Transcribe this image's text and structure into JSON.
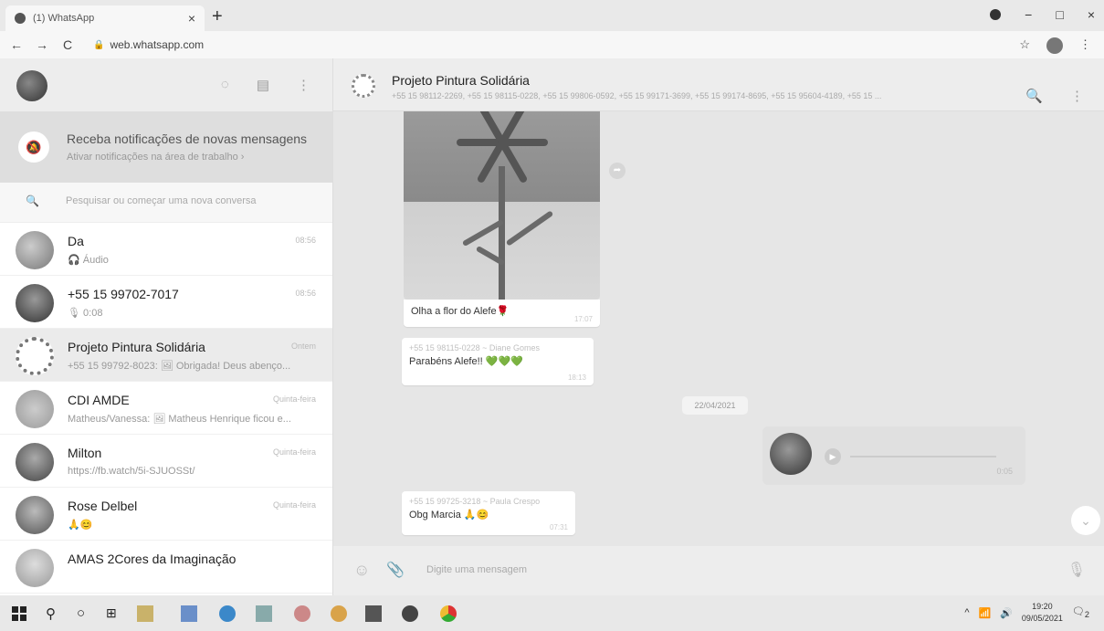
{
  "browser": {
    "tab_title": "(1) WhatsApp",
    "tab_close": "×",
    "new_tab": "+",
    "url": "web.whatsapp.com",
    "back": "←",
    "forward": "→",
    "reload": "C",
    "star": "☆",
    "menu": "⋮",
    "min": "−",
    "max": "□",
    "close": "×"
  },
  "left": {
    "notification": {
      "title": "Receba notificações de novas mensagens",
      "subtitle": "Ativar notificações na área de trabalho ›"
    },
    "search_placeholder": "Pesquisar ou começar uma nova conversa",
    "chats": [
      {
        "name": "Da",
        "time": "08:56",
        "preview": "🎧 Áudio"
      },
      {
        "name": "+55 15 99702-7017",
        "time": "08:56",
        "preview": "🎙 0:08"
      },
      {
        "name": "Projeto Pintura Solidária",
        "time": "Ontem",
        "preview": "+55 15 99792-8023: 🖼 Obrigada! Deus abenço..."
      },
      {
        "name": "CDI AMDE",
        "time": "Quinta-feira",
        "preview": "Matheus/Vanessa: 🖼 Matheus Henrique ficou e..."
      },
      {
        "name": "Milton",
        "time": "Quinta-feira",
        "preview": "https://fb.watch/5i-SJUOSSt/"
      },
      {
        "name": "Rose Delbel",
        "time": "Quinta-feira",
        "preview": "🙏😊"
      },
      {
        "name": "AMAS 2Cores da Imaginação",
        "time": "",
        "preview": ""
      }
    ]
  },
  "conversation": {
    "group_name": "Projeto Pintura Solidária",
    "members": "+55 15 98112-2269, +55 15 98115-0228, +55 15 99806-0592, +55 15 99171-3699, +55 15 99174-8695, +55 15 95604-4189, +55 15 ...",
    "image_caption": "Olha a flor do Alefe🌹",
    "image_time": "17:07",
    "msg2": {
      "sender": "+55 15 98115-0228",
      "sender_name": "~ Diane Gomes",
      "text": "Parabéns Alefe!! 💚💚💚",
      "time": "18:13"
    },
    "date_chip": "22/04/2021",
    "audio": {
      "duration": "0:05",
      "play": "▶"
    },
    "msg3": {
      "sender": "+55 15 99725-3218",
      "sender_name": "~ Paula Crespo",
      "text": "Obg Marcia 🙏😊",
      "time": "07:31"
    },
    "compose_placeholder": "Digite uma mensagem"
  },
  "taskbar": {
    "time": "19:20",
    "date": "09/05/2021",
    "notif_count": "2"
  }
}
